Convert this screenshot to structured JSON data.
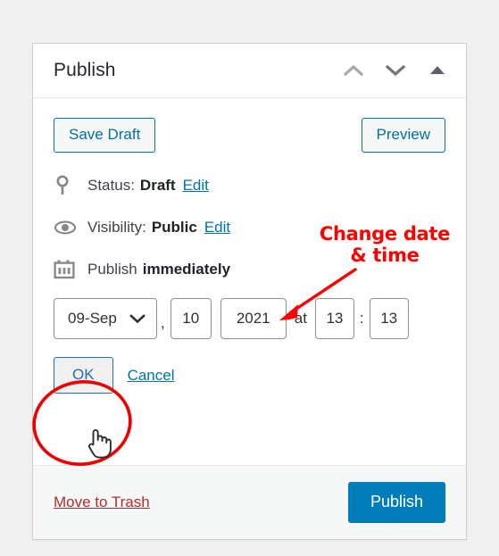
{
  "panel": {
    "title": "Publish",
    "header_icons": [
      {
        "name": "chevron-up-icon",
        "label": "Move up"
      },
      {
        "name": "chevron-down-icon",
        "label": "Move down"
      },
      {
        "name": "triangle-up-icon",
        "label": "Toggle panel"
      }
    ],
    "buttons": {
      "save_draft": "Save Draft",
      "preview": "Preview"
    },
    "status": {
      "icon": "pin-icon",
      "label": "Status:",
      "value": "Draft",
      "edit": "Edit"
    },
    "visibility": {
      "icon": "eye-icon",
      "label": "Visibility:",
      "value": "Public",
      "edit": "Edit"
    },
    "schedule": {
      "icon": "calendar-icon",
      "label": "Publish",
      "value": "immediately",
      "fields": {
        "month": "09-Sep",
        "day": "10",
        "year": "2021",
        "hour": "13",
        "minute": "13"
      },
      "separators": {
        "comma": ",",
        "at": "at",
        "colon": ":"
      },
      "ok": "OK",
      "cancel": "Cancel"
    },
    "footer": {
      "trash": "Move to Trash",
      "publish": "Publish"
    }
  },
  "annotations": {
    "callout_line1": "Change date",
    "callout_line2": "& time",
    "callout_color": "#ff0000",
    "highlight_shape": "ellipse",
    "highlight_target": "OK button",
    "arrow_target": "publish date fields",
    "cursor": "hand-pointer"
  },
  "colors": {
    "page_background": "#f0f0f0",
    "panel_background": "#ffffff",
    "link_blue": "#0073aa",
    "button_blue": "#007cba",
    "trash_red": "#b32d2e",
    "annotation_red": "#ff0000"
  }
}
